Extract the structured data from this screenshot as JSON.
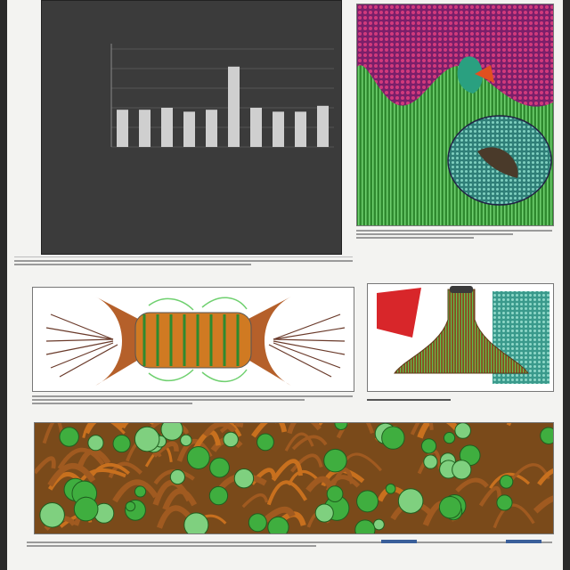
{
  "chart_data": {
    "type": "bar",
    "categories": [
      "",
      "",
      "",
      "",
      "",
      "",
      "",
      "",
      "",
      ""
    ],
    "values": [
      9.5,
      9.5,
      10,
      9,
      9.5,
      20.5,
      10,
      9,
      9,
      10.5
    ],
    "ylim": [
      0,
      25
    ],
    "bar_color": "#cfcfcf",
    "background": "#3b3b3b",
    "gridlines": true
  },
  "colors": {
    "sheet": "#f3f3f1",
    "frame": "#777777",
    "green": "#3fae3f",
    "magenta": "#b02a6a",
    "teal": "#3fa59a",
    "red": "#d8262a",
    "orange": "#c8701e",
    "brown": "#7a4a2a",
    "blue_mark": "#3a5f9a"
  }
}
